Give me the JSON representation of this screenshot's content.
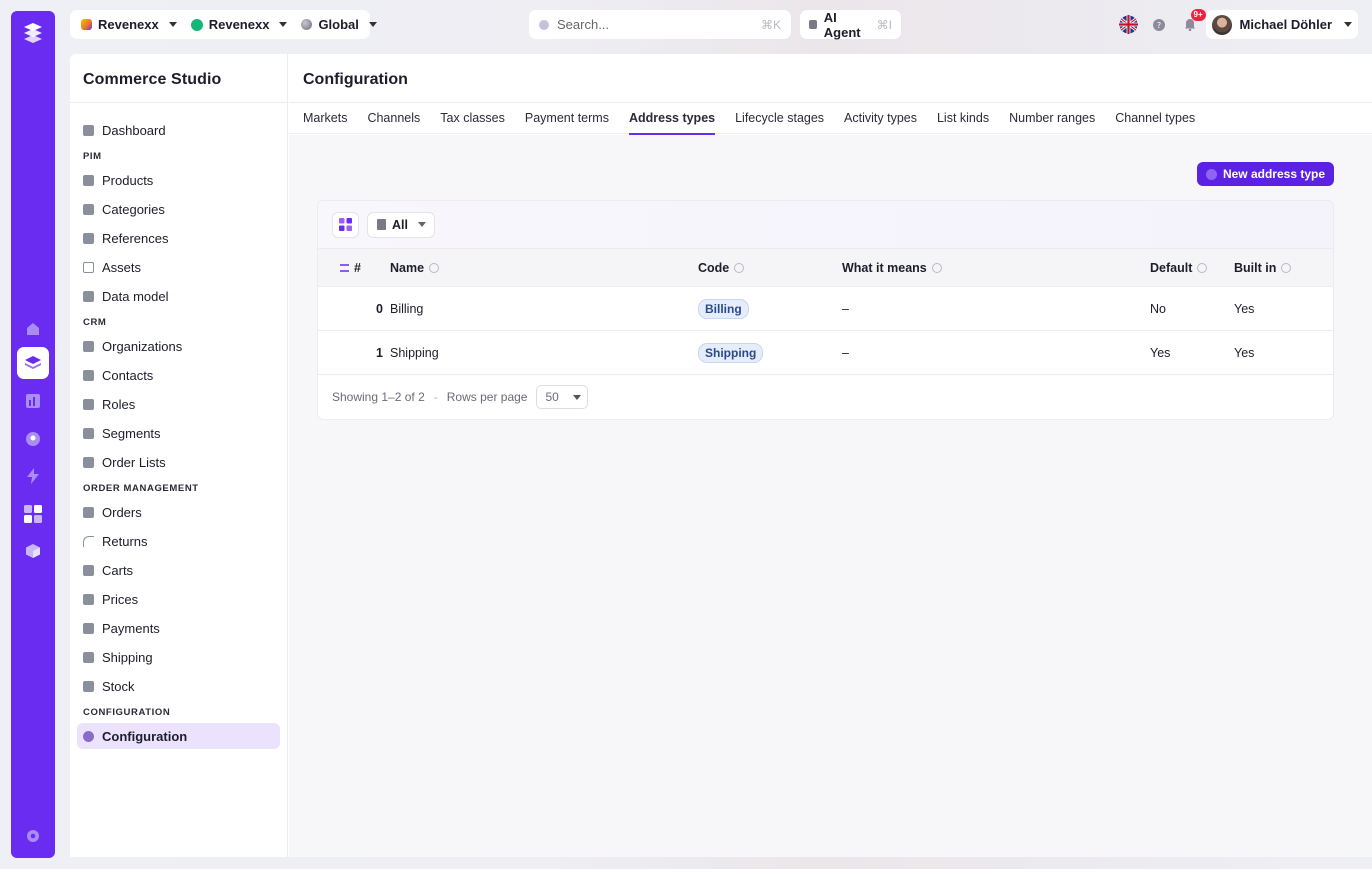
{
  "topbar": {
    "contexts": [
      {
        "label": "Revenexx",
        "icon": "brand-mark-icon"
      },
      {
        "label": "Revenexx",
        "icon": "status-dot-icon",
        "color": "#16b67a"
      },
      {
        "label": "Global",
        "icon": "globe-icon"
      }
    ],
    "search": {
      "placeholder": "Search...",
      "shortcut": "⌘K"
    },
    "agent": {
      "label": "AI Agent",
      "shortcut": "⌘I"
    },
    "notifications_badge": "9+",
    "user_name": "Michael Döhler"
  },
  "sidebar": {
    "title": "Commerce Studio",
    "dashboard": "Dashboard",
    "sections": [
      {
        "heading": "PIM",
        "items": [
          "Products",
          "Categories",
          "References",
          "Assets",
          "Data model"
        ]
      },
      {
        "heading": "CRM",
        "items": [
          "Organizations",
          "Contacts",
          "Roles",
          "Segments",
          "Order Lists"
        ]
      },
      {
        "heading": "ORDER MANAGEMENT",
        "items": [
          "Orders",
          "Returns",
          "Carts",
          "Prices",
          "Payments",
          "Shipping",
          "Stock"
        ]
      },
      {
        "heading": "CONFIGURATION",
        "items": [
          "Configuration"
        ]
      }
    ],
    "active_item": "Configuration"
  },
  "page": {
    "title": "Configuration",
    "tabs": [
      "Markets",
      "Channels",
      "Tax classes",
      "Payment terms",
      "Address types",
      "Lifecycle stages",
      "Activity types",
      "List kinds",
      "Number ranges",
      "Channel types"
    ],
    "active_tab": "Address types",
    "new_button": "New address type"
  },
  "table": {
    "filter_label": "All",
    "headers": {
      "index": "#",
      "name": "Name",
      "code": "Code",
      "meaning": "What it means",
      "default": "Default",
      "built_in": "Built in"
    },
    "rows": [
      {
        "index": "0",
        "name": "Billing",
        "code": "Billing",
        "meaning": "–",
        "default": "No",
        "built_in": "Yes"
      },
      {
        "index": "1",
        "name": "Shipping",
        "code": "Shipping",
        "meaning": "–",
        "default": "Yes",
        "built_in": "Yes"
      }
    ],
    "footer": {
      "showing": "Showing 1–2 of 2",
      "separator": "-",
      "rows_per_page_label": "Rows per page",
      "rows_per_page_value": "50"
    }
  },
  "colors": {
    "accent": "#6a2cf0",
    "button": "#5b22e6",
    "badge": "#f0223e"
  }
}
